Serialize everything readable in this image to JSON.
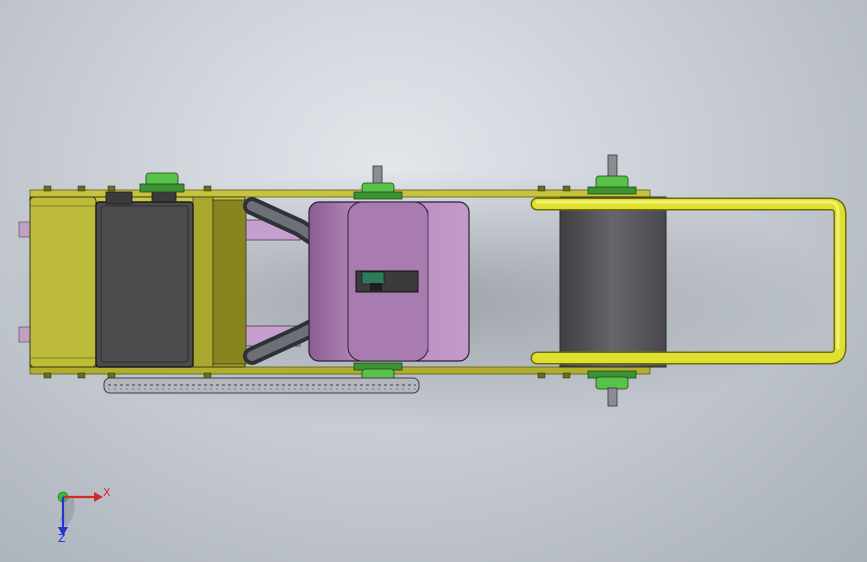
{
  "model": {
    "description_visible": false
  },
  "triad": {
    "x_label": "X",
    "z_label": "Z",
    "x_color": "#d42a2a",
    "y_color": "#2fbf3a",
    "z_color": "#2433c9"
  },
  "colors": {
    "frame": "#b9b62f",
    "yellow_body": "#b6b53a",
    "battery": "#4a4a4c",
    "motor_pink": "#b98ac0",
    "sprocket_green": "#58c24a",
    "roller": "#58585c",
    "handle": "#e3e53a",
    "background": "#c9ced5"
  }
}
